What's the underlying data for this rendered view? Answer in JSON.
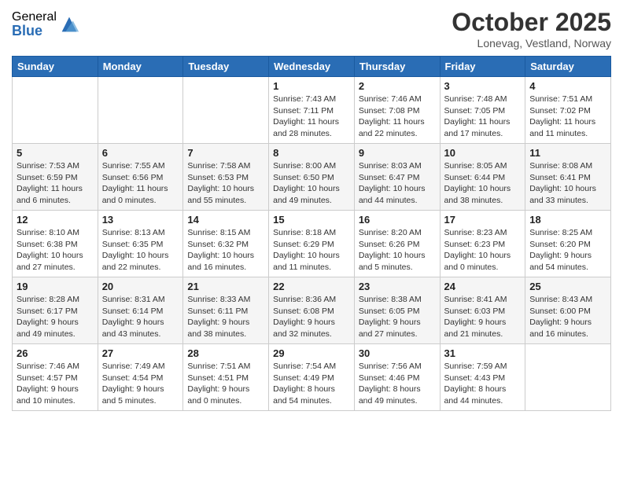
{
  "logo": {
    "general": "General",
    "blue": "Blue"
  },
  "header": {
    "month": "October 2025",
    "location": "Lonevag, Vestland, Norway"
  },
  "weekdays": [
    "Sunday",
    "Monday",
    "Tuesday",
    "Wednesday",
    "Thursday",
    "Friday",
    "Saturday"
  ],
  "weeks": [
    [
      {
        "day": "",
        "sunrise": "",
        "sunset": "",
        "daylight": ""
      },
      {
        "day": "",
        "sunrise": "",
        "sunset": "",
        "daylight": ""
      },
      {
        "day": "",
        "sunrise": "",
        "sunset": "",
        "daylight": ""
      },
      {
        "day": "1",
        "sunrise": "Sunrise: 7:43 AM",
        "sunset": "Sunset: 7:11 PM",
        "daylight": "Daylight: 11 hours and 28 minutes."
      },
      {
        "day": "2",
        "sunrise": "Sunrise: 7:46 AM",
        "sunset": "Sunset: 7:08 PM",
        "daylight": "Daylight: 11 hours and 22 minutes."
      },
      {
        "day": "3",
        "sunrise": "Sunrise: 7:48 AM",
        "sunset": "Sunset: 7:05 PM",
        "daylight": "Daylight: 11 hours and 17 minutes."
      },
      {
        "day": "4",
        "sunrise": "Sunrise: 7:51 AM",
        "sunset": "Sunset: 7:02 PM",
        "daylight": "Daylight: 11 hours and 11 minutes."
      }
    ],
    [
      {
        "day": "5",
        "sunrise": "Sunrise: 7:53 AM",
        "sunset": "Sunset: 6:59 PM",
        "daylight": "Daylight: 11 hours and 6 minutes."
      },
      {
        "day": "6",
        "sunrise": "Sunrise: 7:55 AM",
        "sunset": "Sunset: 6:56 PM",
        "daylight": "Daylight: 11 hours and 0 minutes."
      },
      {
        "day": "7",
        "sunrise": "Sunrise: 7:58 AM",
        "sunset": "Sunset: 6:53 PM",
        "daylight": "Daylight: 10 hours and 55 minutes."
      },
      {
        "day": "8",
        "sunrise": "Sunrise: 8:00 AM",
        "sunset": "Sunset: 6:50 PM",
        "daylight": "Daylight: 10 hours and 49 minutes."
      },
      {
        "day": "9",
        "sunrise": "Sunrise: 8:03 AM",
        "sunset": "Sunset: 6:47 PM",
        "daylight": "Daylight: 10 hours and 44 minutes."
      },
      {
        "day": "10",
        "sunrise": "Sunrise: 8:05 AM",
        "sunset": "Sunset: 6:44 PM",
        "daylight": "Daylight: 10 hours and 38 minutes."
      },
      {
        "day": "11",
        "sunrise": "Sunrise: 8:08 AM",
        "sunset": "Sunset: 6:41 PM",
        "daylight": "Daylight: 10 hours and 33 minutes."
      }
    ],
    [
      {
        "day": "12",
        "sunrise": "Sunrise: 8:10 AM",
        "sunset": "Sunset: 6:38 PM",
        "daylight": "Daylight: 10 hours and 27 minutes."
      },
      {
        "day": "13",
        "sunrise": "Sunrise: 8:13 AM",
        "sunset": "Sunset: 6:35 PM",
        "daylight": "Daylight: 10 hours and 22 minutes."
      },
      {
        "day": "14",
        "sunrise": "Sunrise: 8:15 AM",
        "sunset": "Sunset: 6:32 PM",
        "daylight": "Daylight: 10 hours and 16 minutes."
      },
      {
        "day": "15",
        "sunrise": "Sunrise: 8:18 AM",
        "sunset": "Sunset: 6:29 PM",
        "daylight": "Daylight: 10 hours and 11 minutes."
      },
      {
        "day": "16",
        "sunrise": "Sunrise: 8:20 AM",
        "sunset": "Sunset: 6:26 PM",
        "daylight": "Daylight: 10 hours and 5 minutes."
      },
      {
        "day": "17",
        "sunrise": "Sunrise: 8:23 AM",
        "sunset": "Sunset: 6:23 PM",
        "daylight": "Daylight: 10 hours and 0 minutes."
      },
      {
        "day": "18",
        "sunrise": "Sunrise: 8:25 AM",
        "sunset": "Sunset: 6:20 PM",
        "daylight": "Daylight: 9 hours and 54 minutes."
      }
    ],
    [
      {
        "day": "19",
        "sunrise": "Sunrise: 8:28 AM",
        "sunset": "Sunset: 6:17 PM",
        "daylight": "Daylight: 9 hours and 49 minutes."
      },
      {
        "day": "20",
        "sunrise": "Sunrise: 8:31 AM",
        "sunset": "Sunset: 6:14 PM",
        "daylight": "Daylight: 9 hours and 43 minutes."
      },
      {
        "day": "21",
        "sunrise": "Sunrise: 8:33 AM",
        "sunset": "Sunset: 6:11 PM",
        "daylight": "Daylight: 9 hours and 38 minutes."
      },
      {
        "day": "22",
        "sunrise": "Sunrise: 8:36 AM",
        "sunset": "Sunset: 6:08 PM",
        "daylight": "Daylight: 9 hours and 32 minutes."
      },
      {
        "day": "23",
        "sunrise": "Sunrise: 8:38 AM",
        "sunset": "Sunset: 6:05 PM",
        "daylight": "Daylight: 9 hours and 27 minutes."
      },
      {
        "day": "24",
        "sunrise": "Sunrise: 8:41 AM",
        "sunset": "Sunset: 6:03 PM",
        "daylight": "Daylight: 9 hours and 21 minutes."
      },
      {
        "day": "25",
        "sunrise": "Sunrise: 8:43 AM",
        "sunset": "Sunset: 6:00 PM",
        "daylight": "Daylight: 9 hours and 16 minutes."
      }
    ],
    [
      {
        "day": "26",
        "sunrise": "Sunrise: 7:46 AM",
        "sunset": "Sunset: 4:57 PM",
        "daylight": "Daylight: 9 hours and 10 minutes."
      },
      {
        "day": "27",
        "sunrise": "Sunrise: 7:49 AM",
        "sunset": "Sunset: 4:54 PM",
        "daylight": "Daylight: 9 hours and 5 minutes."
      },
      {
        "day": "28",
        "sunrise": "Sunrise: 7:51 AM",
        "sunset": "Sunset: 4:51 PM",
        "daylight": "Daylight: 9 hours and 0 minutes."
      },
      {
        "day": "29",
        "sunrise": "Sunrise: 7:54 AM",
        "sunset": "Sunset: 4:49 PM",
        "daylight": "Daylight: 8 hours and 54 minutes."
      },
      {
        "day": "30",
        "sunrise": "Sunrise: 7:56 AM",
        "sunset": "Sunset: 4:46 PM",
        "daylight": "Daylight: 8 hours and 49 minutes."
      },
      {
        "day": "31",
        "sunrise": "Sunrise: 7:59 AM",
        "sunset": "Sunset: 4:43 PM",
        "daylight": "Daylight: 8 hours and 44 minutes."
      },
      {
        "day": "",
        "sunrise": "",
        "sunset": "",
        "daylight": ""
      }
    ]
  ]
}
